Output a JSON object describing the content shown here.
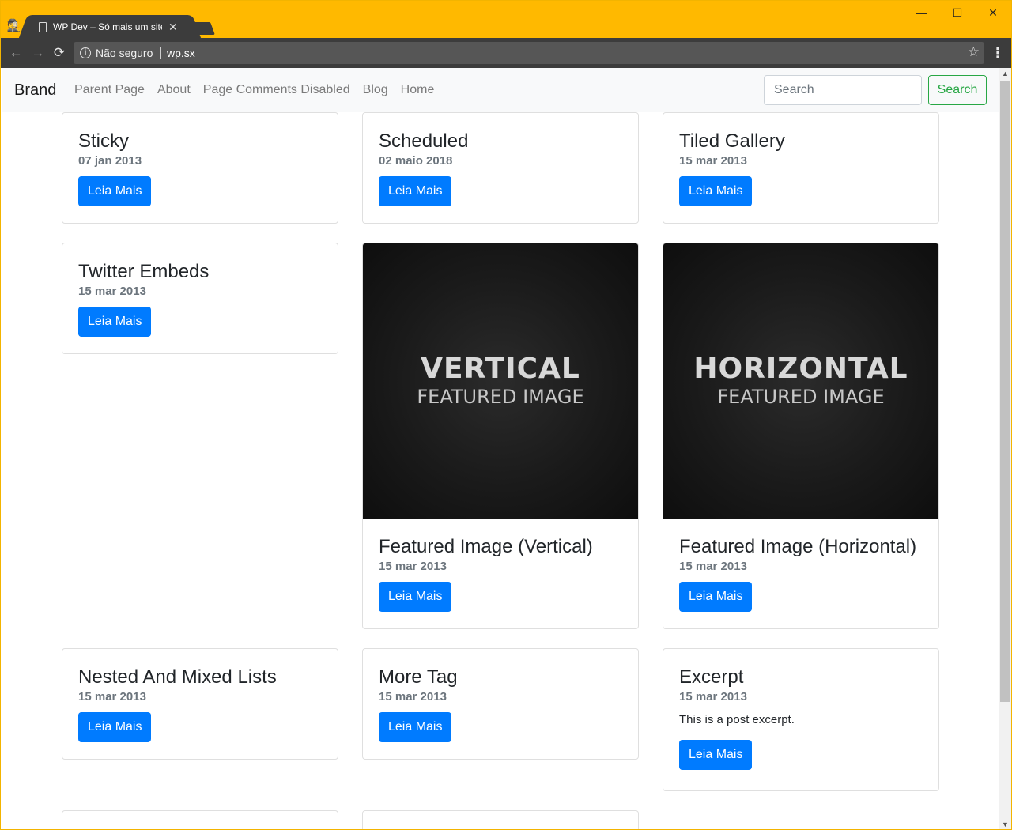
{
  "browser": {
    "tab_title": "WP Dev – Só mais um site",
    "security_label": "Não seguro",
    "url": "wp.sx",
    "minimize": "—",
    "maximize": "☐",
    "close": "✕"
  },
  "navbar": {
    "brand": "Brand",
    "links": [
      "Parent Page",
      "About",
      "Page Comments Disabled",
      "Blog",
      "Home"
    ],
    "search_placeholder": "Search",
    "search_button": "Search"
  },
  "read_more_label": "Leia Mais",
  "posts": [
    {
      "title": "Sticky",
      "date": "07 jan 2013"
    },
    {
      "title": "Scheduled",
      "date": "02 maio 2018"
    },
    {
      "title": "Tiled Gallery",
      "date": "15 mar 2013"
    },
    {
      "title": "Twitter Embeds",
      "date": "15 mar 2013"
    },
    {
      "title": "Featured Image (Vertical)",
      "date": "15 mar 2013",
      "image_main": "VERTICAL",
      "image_sub": "FEATURED IMAGE"
    },
    {
      "title": "Featured Image (Horizontal)",
      "date": "15 mar 2013",
      "image_main": "HORIZONTAL",
      "image_sub": "FEATURED IMAGE"
    },
    {
      "title": "Nested And Mixed Lists",
      "date": "15 mar 2013"
    },
    {
      "title": "More Tag",
      "date": "15 mar 2013"
    },
    {
      "title": "Excerpt",
      "date": "15 mar 2013",
      "excerpt": "This is a post excerpt."
    }
  ],
  "colors": {
    "titlebar": "#ffb900",
    "toolbar": "#3c3c3c",
    "primary_button": "#007bff",
    "search_button": "#28a745"
  }
}
